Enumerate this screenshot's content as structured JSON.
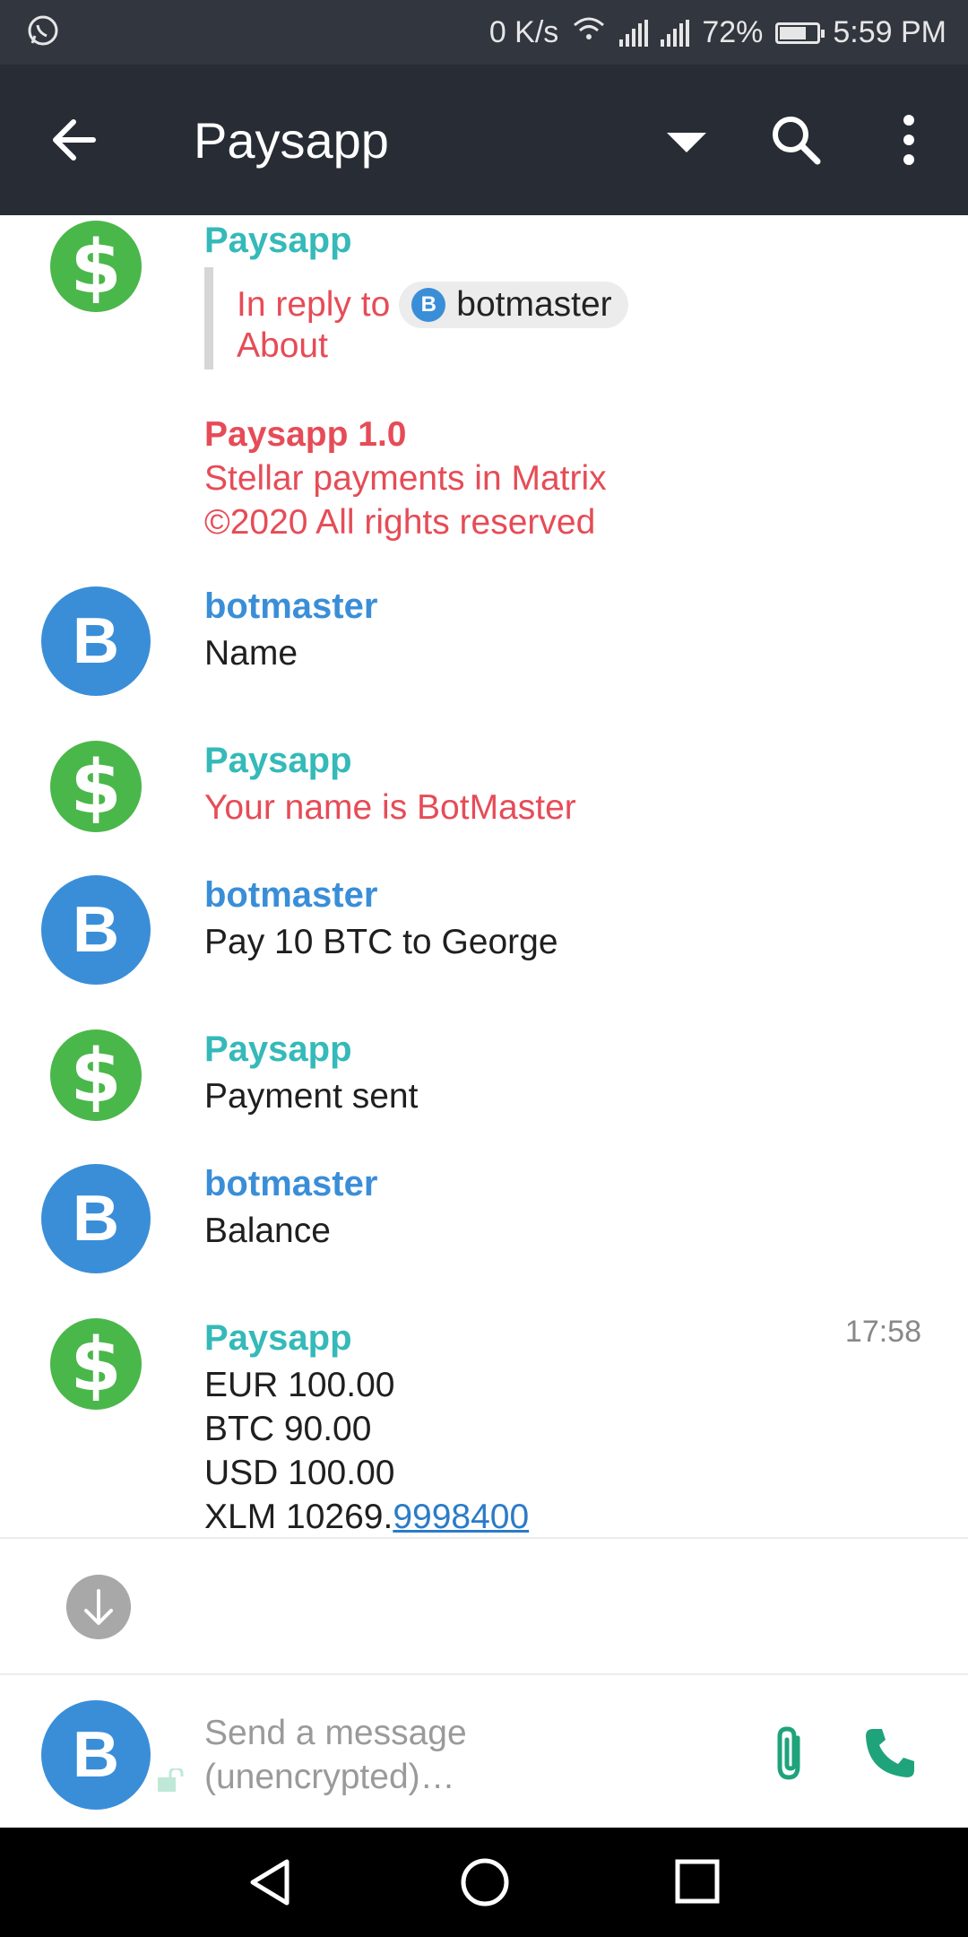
{
  "status_bar": {
    "app_icon": "whatsapp-icon",
    "speed": "0 K/s",
    "battery": "72%",
    "battery_level": 0.72,
    "time": "5:59 PM"
  },
  "app_bar": {
    "title": "Paysapp",
    "icons": [
      "back-arrow-icon",
      "dropdown-icon",
      "search-icon",
      "more-vert-icon"
    ]
  },
  "messages": [
    {
      "sender": "Paysapp",
      "reply": {
        "prefix": "In reply to",
        "user": "botmaster",
        "user_initial": "B",
        "quoted_text": "About"
      },
      "lines": [
        "Paysapp 1.0",
        "Stellar payments in Matrix",
        "©2020 All rights reserved"
      ]
    },
    {
      "sender": "botmaster",
      "initial": "B",
      "text": "Name"
    },
    {
      "sender": "Paysapp",
      "text": "Your name is BotMaster"
    },
    {
      "sender": "botmaster",
      "initial": "B",
      "text": "Pay 10 BTC to George"
    },
    {
      "sender": "Paysapp",
      "text": "Payment sent"
    },
    {
      "sender": "botmaster",
      "initial": "B",
      "text": "Balance"
    },
    {
      "sender": "Paysapp",
      "timestamp": "17:58",
      "lines": [
        "EUR 100.00",
        "BTC 90.00",
        "USD 100.00"
      ],
      "last_line_prefix": "XLM 10269.",
      "last_line_link": "9998400"
    }
  ],
  "composer": {
    "avatar_initial": "B",
    "placeholder_line1": "Send a message",
    "placeholder_line2": "(unencrypted)…",
    "icons": [
      "unlock-icon",
      "attachment-icon",
      "phone-icon"
    ]
  },
  "nav_bar": {
    "icons": [
      "back-triangle-icon",
      "home-circle-icon",
      "recents-square-icon"
    ]
  }
}
